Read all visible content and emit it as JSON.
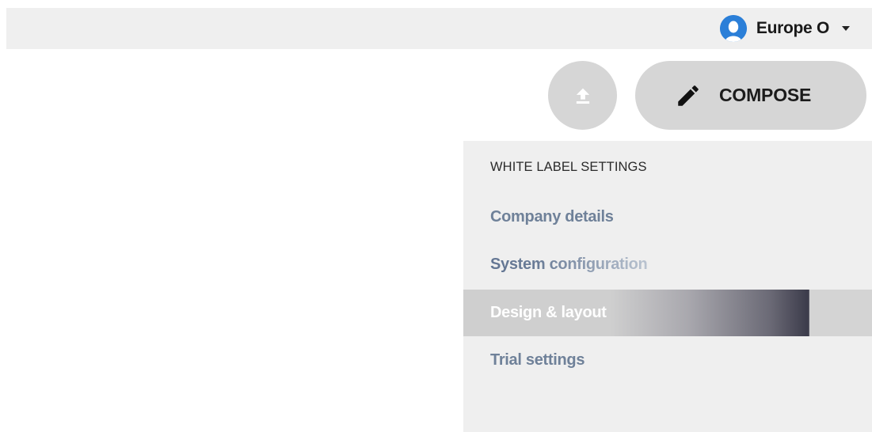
{
  "header": {
    "user_name": "Europe O"
  },
  "actions": {
    "compose_label": "COMPOSE"
  },
  "settings_menu": {
    "heading": "WHITE LABEL SETTINGS",
    "items": [
      {
        "label": "Company details",
        "active": false
      },
      {
        "label": "System configuration",
        "active": false
      },
      {
        "label": "Design & layout",
        "active": true
      },
      {
        "label": "Trial settings",
        "active": false
      }
    ]
  },
  "colors": {
    "avatar_bg": "#2b7fd8",
    "topbar_bg": "#efefef",
    "button_bg": "#d6d6d6",
    "link_text": "#6f8199",
    "active_item_text": "#ffffff"
  },
  "icons": {
    "avatar": "user-avatar-icon",
    "caret": "caret-down-icon",
    "upload": "upload-icon",
    "compose": "pencil-icon"
  }
}
